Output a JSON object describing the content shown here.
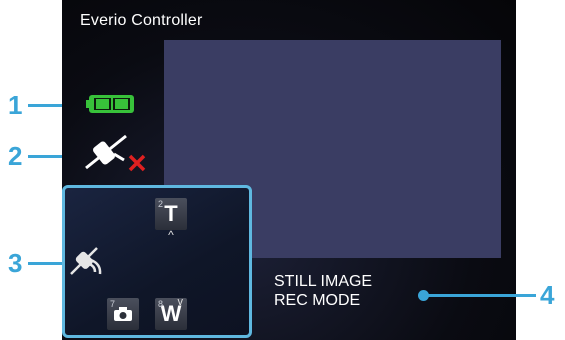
{
  "window": {
    "title": "Everio Controller"
  },
  "status": {
    "battery_icon": "battery-full-icon",
    "gps_icon": "gps-disconnected-icon"
  },
  "controls": {
    "zoom_tele": {
      "label": "T",
      "number": "2"
    },
    "snapshot": {
      "number": "7"
    },
    "zoom_wide": {
      "label": "W",
      "number": "8"
    }
  },
  "mode": {
    "line1": "STILL IMAGE",
    "line2": "REC MODE"
  },
  "callouts": {
    "c1": "1",
    "c2": "2",
    "c3": "3",
    "c4": "4"
  },
  "colors": {
    "accent": "#3aa5d8",
    "battery": "#38c23a",
    "preview": "#3a3d63",
    "error": "#e02020"
  }
}
